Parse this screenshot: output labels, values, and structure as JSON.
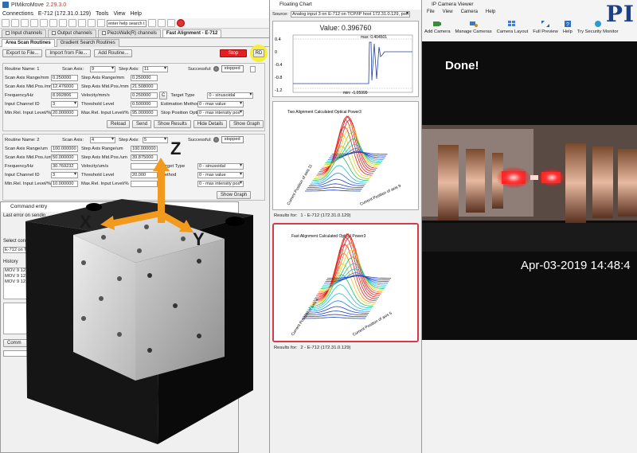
{
  "pimikromove": {
    "title": "PIMikroMove",
    "version": "2.29.3.0",
    "menu": [
      "Connections",
      "E-712 (172.31.0.129)",
      "Tools",
      "View",
      "Help"
    ],
    "toolbar_input": "enter help search t",
    "tabs": [
      "Input channels",
      "Output channels",
      "PiezoWalk(R) channels",
      "Fast Alignment - E-712"
    ],
    "subtabs": [
      "Area Scan Routines",
      "Gradient Search Routines"
    ],
    "actions": {
      "export": "Export to File...",
      "import": "Import from File...",
      "add": "Add Routine...",
      "stop": "Stop",
      "go": "RD"
    },
    "routine1": {
      "name_label": "Routine Name: 1",
      "scan_axis_label": "Scan Axis:",
      "scan_axis": "9",
      "step_axis_label": "Step Axis:",
      "step_axis": "11",
      "successful_label": "Successful:",
      "status": "stopped",
      "rows": [
        {
          "l1": "Scan Axis Range/mm",
          "v1": "0.250000",
          "l2": "Step Axis Range/mm",
          "v2": "0.250000"
        },
        {
          "l1": "Scan Axis Mid.Pos./mm",
          "v1": "12.476000",
          "l2": "Step Axis Mid.Pos./mm",
          "v2": "21.508000"
        },
        {
          "l1": "Frequency/Hz",
          "v1": "8.992806",
          "l2": "Velocity/mm/s",
          "v2": "0.250000"
        },
        {
          "l1": "Input Channel ID",
          "v1": "3",
          "l2": "Threshold Level",
          "v2": "0.500000"
        },
        {
          "l1": "Min.Rel. Input Level/%",
          "v1": "20.000000",
          "l2": "Max.Rel. Input Level/%",
          "v2": "95.000000"
        }
      ],
      "c_label": "C",
      "right": [
        {
          "l": "Target Type",
          "v": "0 - sinusoidal"
        },
        {
          "l": "Estimation Method",
          "v": "0 - max value"
        },
        {
          "l": "Stop Position Option",
          "v": "0 - max intensity pos"
        }
      ],
      "buttons": [
        "Reload",
        "Send",
        "Show Results",
        "Hide Details",
        "Show Graph"
      ]
    },
    "routine2": {
      "name_label": "Routine Name: 2",
      "scan_axis_label": "Scan Axis:",
      "scan_axis": "4",
      "step_axis_label": "Step Axis:",
      "step_axis": "5",
      "successful_label": "Successful:",
      "status": "stopped",
      "rows": [
        {
          "l1": "Scan Axis Range/um",
          "v1": "100.000000",
          "l2": "Step Axis Range/um",
          "v2": "100.000000"
        },
        {
          "l1": "Scan Axis Mid.Pos./um",
          "v1": "50.000000",
          "l2": "Step Axis Mid.Pos./um",
          "v2": "39.875000"
        },
        {
          "l1": "Frequency/Hz",
          "v1": "30.769232",
          "l2": "Velocity/um/s",
          "v2": ""
        },
        {
          "l1": "Input Channel ID",
          "v1": "3",
          "l2": "Threshold Level",
          "v2": "20.000"
        },
        {
          "l1": "Min.Rel. Input Level/%",
          "v1": "10.000000",
          "l2": "Max.Rel. Input Level/%",
          "v2": ""
        }
      ],
      "right": [
        {
          "l": "Target Type",
          "v": "0 - sinusoidal"
        },
        {
          "l": "Method",
          "v": "0 - max value"
        },
        {
          "l": "",
          "v": "0 - max intensity pos"
        }
      ],
      "button": "Show Graph"
    },
    "command_entry": {
      "title": "Command entry",
      "last_error": "Last error on sendin",
      "select": "Select contr",
      "device": "E-712 on TC",
      "history_label": "History",
      "history": [
        "MOV 9 12.",
        "MOV 9 12.",
        "MOV 9 12."
      ],
      "command_btn": "Comm"
    },
    "overlay": {
      "axis_x": "X",
      "axis_y": "Y",
      "axis_z": "Z"
    }
  },
  "floating_chart": {
    "title": "Floating Chart",
    "source_label": "Source:",
    "source": "Analog input 3 on E-712 on TCP/IP host 172.31.0.129, port 5",
    "value": "Value: 0.396760",
    "max": "max: 0.404501",
    "min": "min: -1.05999",
    "yticks": [
      "0.4",
      "0",
      "-0.4",
      "-0.8",
      "-1.2"
    ],
    "plot1_title": "Two Alignment Calculated Optical Power3",
    "plot1_y": "Current Position of axis 11",
    "plot1_x": "Current Position of axis 9",
    "results_label": "Results for:",
    "results": "1 - E-712 (172.31.0.129)",
    "plot2_title": "Fast Alignment Calculated Optical Power3",
    "plot2_y": "Current Position of axis 4",
    "plot2_x": "Current Position of axis 5",
    "results2": "2 - E-712 (172.31.0.129)"
  },
  "camera": {
    "title": "IP Camera Viewer",
    "menu": [
      "File",
      "View",
      "Camera",
      "Help"
    ],
    "tools": [
      "Add Camera",
      "Manage Cameras",
      "Camera Layout",
      "Full Preview",
      "Help",
      "Try Security Monitor"
    ],
    "logo": "PI",
    "done": "Done!",
    "timestamp": "Apr-03-2019 14:48:4"
  }
}
